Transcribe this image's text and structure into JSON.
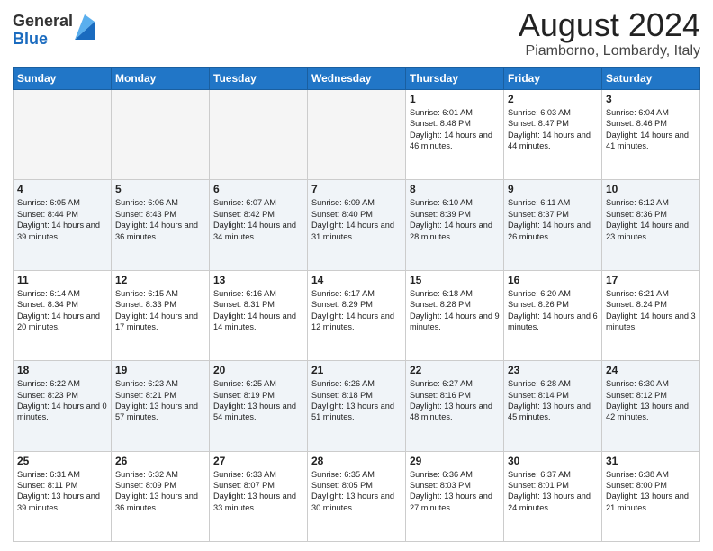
{
  "header": {
    "logo_general": "General",
    "logo_blue": "Blue",
    "month_title": "August 2024",
    "location": "Piamborno, Lombardy, Italy"
  },
  "weekdays": [
    "Sunday",
    "Monday",
    "Tuesday",
    "Wednesday",
    "Thursday",
    "Friday",
    "Saturday"
  ],
  "weeks": [
    [
      {
        "day": "",
        "info": ""
      },
      {
        "day": "",
        "info": ""
      },
      {
        "day": "",
        "info": ""
      },
      {
        "day": "",
        "info": ""
      },
      {
        "day": "1",
        "info": "Sunrise: 6:01 AM\nSunset: 8:48 PM\nDaylight: 14 hours and 46 minutes."
      },
      {
        "day": "2",
        "info": "Sunrise: 6:03 AM\nSunset: 8:47 PM\nDaylight: 14 hours and 44 minutes."
      },
      {
        "day": "3",
        "info": "Sunrise: 6:04 AM\nSunset: 8:46 PM\nDaylight: 14 hours and 41 minutes."
      }
    ],
    [
      {
        "day": "4",
        "info": "Sunrise: 6:05 AM\nSunset: 8:44 PM\nDaylight: 14 hours and 39 minutes."
      },
      {
        "day": "5",
        "info": "Sunrise: 6:06 AM\nSunset: 8:43 PM\nDaylight: 14 hours and 36 minutes."
      },
      {
        "day": "6",
        "info": "Sunrise: 6:07 AM\nSunset: 8:42 PM\nDaylight: 14 hours and 34 minutes."
      },
      {
        "day": "7",
        "info": "Sunrise: 6:09 AM\nSunset: 8:40 PM\nDaylight: 14 hours and 31 minutes."
      },
      {
        "day": "8",
        "info": "Sunrise: 6:10 AM\nSunset: 8:39 PM\nDaylight: 14 hours and 28 minutes."
      },
      {
        "day": "9",
        "info": "Sunrise: 6:11 AM\nSunset: 8:37 PM\nDaylight: 14 hours and 26 minutes."
      },
      {
        "day": "10",
        "info": "Sunrise: 6:12 AM\nSunset: 8:36 PM\nDaylight: 14 hours and 23 minutes."
      }
    ],
    [
      {
        "day": "11",
        "info": "Sunrise: 6:14 AM\nSunset: 8:34 PM\nDaylight: 14 hours and 20 minutes."
      },
      {
        "day": "12",
        "info": "Sunrise: 6:15 AM\nSunset: 8:33 PM\nDaylight: 14 hours and 17 minutes."
      },
      {
        "day": "13",
        "info": "Sunrise: 6:16 AM\nSunset: 8:31 PM\nDaylight: 14 hours and 14 minutes."
      },
      {
        "day": "14",
        "info": "Sunrise: 6:17 AM\nSunset: 8:29 PM\nDaylight: 14 hours and 12 minutes."
      },
      {
        "day": "15",
        "info": "Sunrise: 6:18 AM\nSunset: 8:28 PM\nDaylight: 14 hours and 9 minutes."
      },
      {
        "day": "16",
        "info": "Sunrise: 6:20 AM\nSunset: 8:26 PM\nDaylight: 14 hours and 6 minutes."
      },
      {
        "day": "17",
        "info": "Sunrise: 6:21 AM\nSunset: 8:24 PM\nDaylight: 14 hours and 3 minutes."
      }
    ],
    [
      {
        "day": "18",
        "info": "Sunrise: 6:22 AM\nSunset: 8:23 PM\nDaylight: 14 hours and 0 minutes."
      },
      {
        "day": "19",
        "info": "Sunrise: 6:23 AM\nSunset: 8:21 PM\nDaylight: 13 hours and 57 minutes."
      },
      {
        "day": "20",
        "info": "Sunrise: 6:25 AM\nSunset: 8:19 PM\nDaylight: 13 hours and 54 minutes."
      },
      {
        "day": "21",
        "info": "Sunrise: 6:26 AM\nSunset: 8:18 PM\nDaylight: 13 hours and 51 minutes."
      },
      {
        "day": "22",
        "info": "Sunrise: 6:27 AM\nSunset: 8:16 PM\nDaylight: 13 hours and 48 minutes."
      },
      {
        "day": "23",
        "info": "Sunrise: 6:28 AM\nSunset: 8:14 PM\nDaylight: 13 hours and 45 minutes."
      },
      {
        "day": "24",
        "info": "Sunrise: 6:30 AM\nSunset: 8:12 PM\nDaylight: 13 hours and 42 minutes."
      }
    ],
    [
      {
        "day": "25",
        "info": "Sunrise: 6:31 AM\nSunset: 8:11 PM\nDaylight: 13 hours and 39 minutes."
      },
      {
        "day": "26",
        "info": "Sunrise: 6:32 AM\nSunset: 8:09 PM\nDaylight: 13 hours and 36 minutes."
      },
      {
        "day": "27",
        "info": "Sunrise: 6:33 AM\nSunset: 8:07 PM\nDaylight: 13 hours and 33 minutes."
      },
      {
        "day": "28",
        "info": "Sunrise: 6:35 AM\nSunset: 8:05 PM\nDaylight: 13 hours and 30 minutes."
      },
      {
        "day": "29",
        "info": "Sunrise: 6:36 AM\nSunset: 8:03 PM\nDaylight: 13 hours and 27 minutes."
      },
      {
        "day": "30",
        "info": "Sunrise: 6:37 AM\nSunset: 8:01 PM\nDaylight: 13 hours and 24 minutes."
      },
      {
        "day": "31",
        "info": "Sunrise: 6:38 AM\nSunset: 8:00 PM\nDaylight: 13 hours and 21 minutes."
      }
    ]
  ]
}
